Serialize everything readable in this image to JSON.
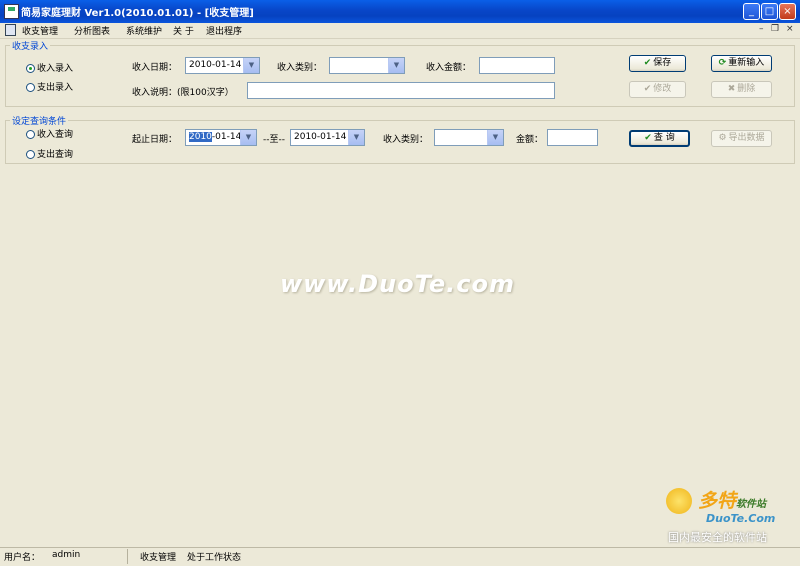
{
  "window": {
    "title": "简易家庭理财 Ver1.0(2010.01.01) - [收支管理]",
    "min": "_",
    "max": "□",
    "close": "×"
  },
  "menu": {
    "items": [
      "收支管理",
      "分析图表",
      "系统维护",
      "关 于",
      "退出程序"
    ],
    "mdi_min": "–",
    "mdi_restore": "❐",
    "mdi_close": "×"
  },
  "entry": {
    "legend": "收支录入",
    "radio_income": "收入录入",
    "radio_expense": "支出录入",
    "date_label": "收入日期：",
    "date_value": "2010-01-14",
    "category_label": "收入类别：",
    "category_value": "",
    "amount_label": "收入金额：",
    "amount_value": "",
    "desc_label": "收入说明：(限100汉字）",
    "desc_value": "",
    "save": "保存",
    "reset": "重新输入",
    "modify": "修改",
    "delete": "删除"
  },
  "query": {
    "legend": "设定查询条件",
    "radio_income": "收入查询",
    "radio_expense": "支出查询",
    "date_label": "起止日期：",
    "date_from_selected": "2010",
    "date_from_rest": "-01-14",
    "to_label": "--至--",
    "date_to": "2010-01-14",
    "category_label": "收入类别：",
    "category_value": "",
    "amount_label": "金额：",
    "amount_value": "",
    "search": "查 询",
    "export": "导出数据"
  },
  "watermark": "www.DuoTe.com",
  "logo": {
    "brand": "多特",
    "brand_small": "软件站",
    "site": "DuoTe.Com",
    "slogan": "国内最安全的软件站"
  },
  "status": {
    "user_label": "用户名：",
    "user": "admin",
    "module": "收支管理",
    "state": "处于工作状态"
  }
}
